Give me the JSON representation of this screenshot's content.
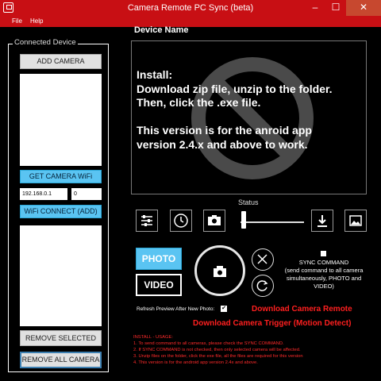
{
  "window": {
    "title": "Camera Remote PC Sync (beta)",
    "minimize": "–",
    "maximize": "☐",
    "close": "✕"
  },
  "menu": {
    "file": "File",
    "help": "Help"
  },
  "sidebar": {
    "group_label": "Connected Device",
    "add_camera": "ADD CAMERA",
    "get_wifi": "GET CAMERA WiFi",
    "ip_value": "192.168.0.1",
    "port_value": "0",
    "wifi_connect": "WiFi CONNECT (ADD)",
    "remove_selected": "REMOVE SELECTED",
    "remove_all": "REMOVE ALL CAMERA"
  },
  "main": {
    "device_name": "Device Name",
    "preview_text": "Install:\nDownload zip file, unzip to the folder.\nThen, click the .exe file.\n\nThis version is for the anroid app\nversion 2.4.x and above to work.",
    "status_label": "Status",
    "status_level": 0.03,
    "photo_label": "PHOTO",
    "video_label": "VIDEO",
    "sync_command_text": "SYNC COMMAND\n(send command to all camera simultaneously, PHOTO and VIDEO)",
    "refresh_label": "Refresh Preview After New Photo:",
    "refresh_checked": "✔",
    "download_remote": "Download Camera Remote",
    "download_trigger": "Download Camera Trigger (Motion Detect)",
    "install_usage": [
      "INSTALL - USAGE:",
      "1. To send command to all cameras, please check the SYNC COMMAND.",
      "2. If SYNC COMMAND is not checked, then only selected camera will be affected.",
      "3. Unzip files on the folder, click the exe file, all the files are required for this version",
      "4. This version is for the android app version 2.4x and above."
    ]
  },
  "colors": {
    "titlebar": "#c80f14",
    "accent_blue": "#5ac4f2",
    "link_red": "#ff1f1f"
  }
}
